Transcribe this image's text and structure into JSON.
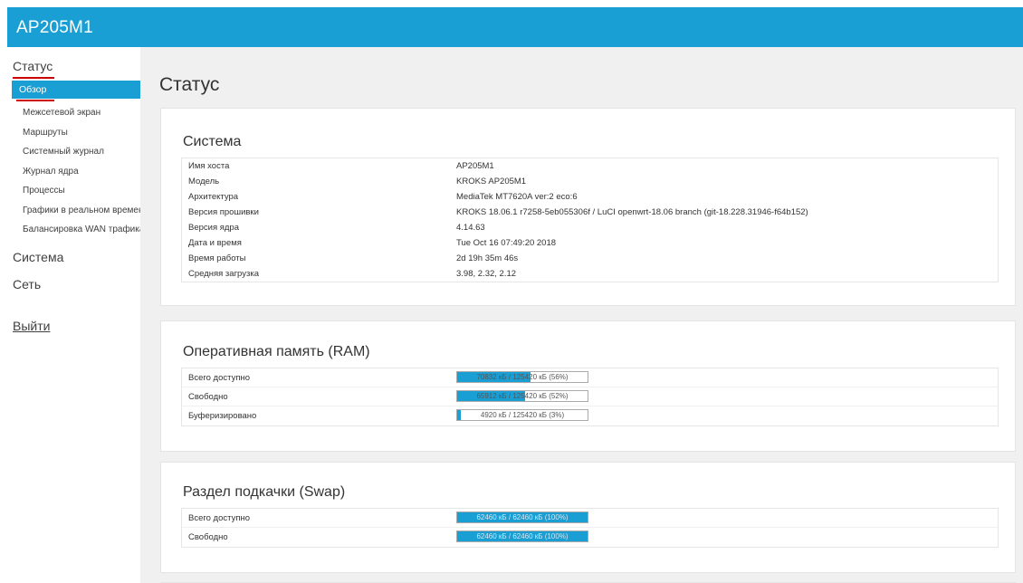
{
  "app": {
    "title": "AP205M1"
  },
  "sidebar": {
    "status_label": "Статус",
    "active_sub": "Обзор",
    "sub_items": [
      "Межсетевой экран",
      "Маршруты",
      "Системный журнал",
      "Журнал ядра",
      "Процессы",
      "Графики в реальном времени",
      "Балансировка WAN трафика"
    ],
    "system_label": "Система",
    "network_label": "Сеть",
    "logout_label": "Выйти"
  },
  "page": {
    "title": "Статус"
  },
  "system": {
    "title": "Система",
    "rows": [
      {
        "key": "Имя хоста",
        "value": "AP205M1"
      },
      {
        "key": "Модель",
        "value": "KROKS AP205M1"
      },
      {
        "key": "Архитектура",
        "value": "MediaTek MT7620A ver:2 eco:6"
      },
      {
        "key": "Версия прошивки",
        "value": "KROKS 18.06.1 r7258-5eb055306f / LuCI openwrt-18.06 branch (git-18.228.31946-f64b152)"
      },
      {
        "key": "Версия ядра",
        "value": "4.14.63"
      },
      {
        "key": "Дата и время",
        "value": "Tue Oct 16 07:49:20 2018"
      },
      {
        "key": "Время работы",
        "value": "2d 19h 35m 46s"
      },
      {
        "key": "Средняя загрузка",
        "value": "3.98, 2.32, 2.12"
      }
    ]
  },
  "ram": {
    "title": "Оперативная память (RAM)",
    "rows": [
      {
        "key": "Всего доступно",
        "text": "70832 кБ / 125420 кБ (56%)",
        "percent": 56
      },
      {
        "key": "Свободно",
        "text": "65912 кБ / 125420 кБ (52%)",
        "percent": 52
      },
      {
        "key": "Буферизировано",
        "text": "4920 кБ / 125420 кБ (3%)",
        "percent": 3
      }
    ]
  },
  "swap": {
    "title": "Раздел подкачки (Swap)",
    "rows": [
      {
        "key": "Всего доступно",
        "text": "62460 кБ / 62460 кБ (100%)",
        "percent": 100
      },
      {
        "key": "Свободно",
        "text": "62460 кБ / 62460 кБ (100%)",
        "percent": 100
      }
    ]
  },
  "colors": {
    "accent": "#1a9fd4",
    "marker": "#cc0000"
  }
}
